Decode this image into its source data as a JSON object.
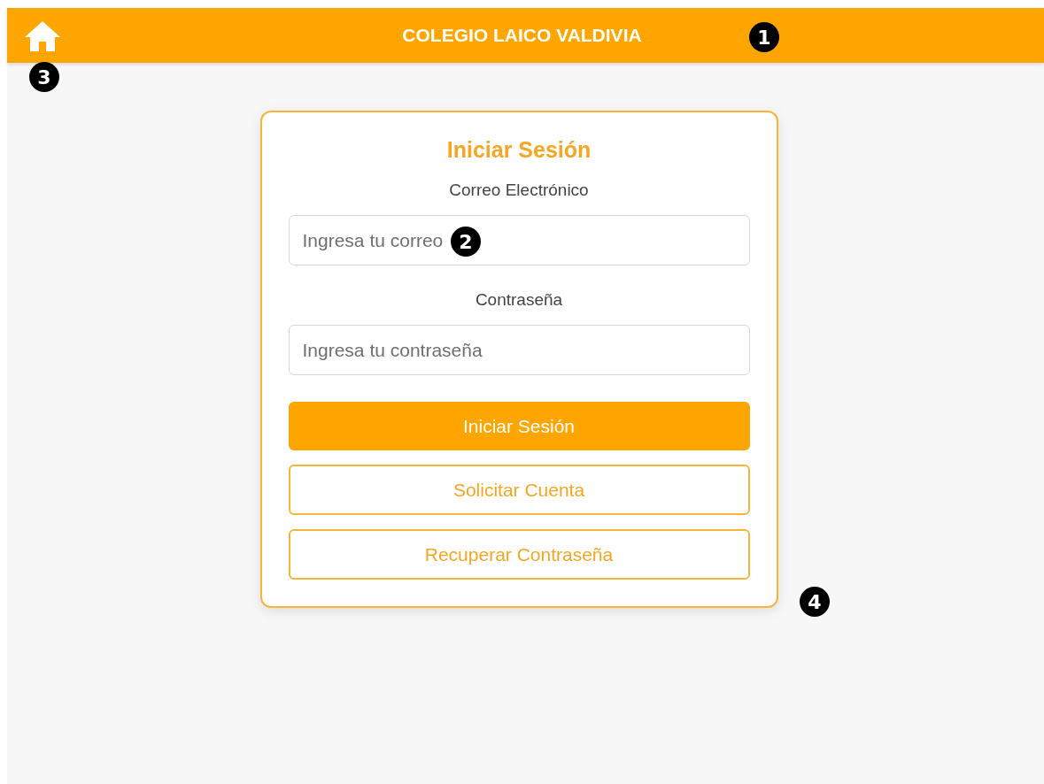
{
  "header": {
    "title": "COLEGIO LAICO VALDIVIA"
  },
  "login": {
    "title": "Iniciar Sesión",
    "fields": [
      {
        "label": "Correo Electrónico",
        "placeholder": "Ingresa tu correo"
      },
      {
        "label": "Contraseña",
        "placeholder": "Ingresa tu contraseña"
      }
    ],
    "buttons": [
      {
        "label": "Iniciar Sesión",
        "kind": "primary"
      },
      {
        "label": "Solicitar Cuenta",
        "kind": "outline"
      },
      {
        "label": "Recuperar Contraseña",
        "kind": "outline"
      }
    ]
  },
  "callouts": [
    "1",
    "2",
    "3",
    "4"
  ]
}
